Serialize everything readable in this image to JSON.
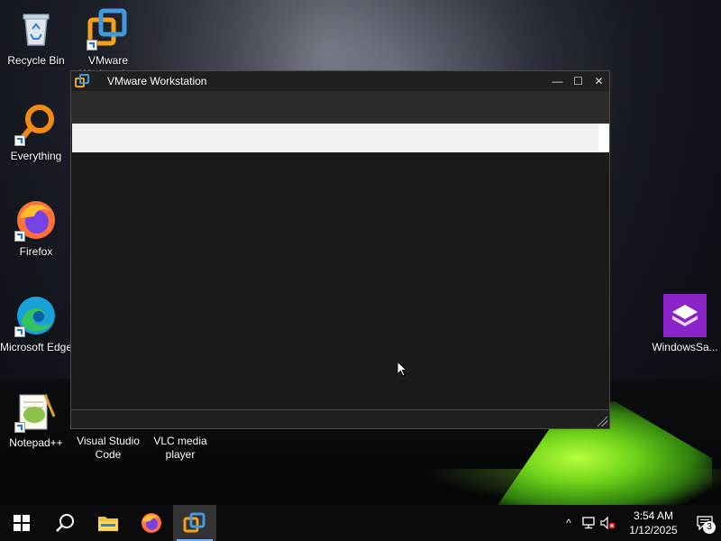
{
  "desktop": {
    "icons": [
      {
        "label": "Recycle Bin"
      },
      {
        "label": "VMware Workstation"
      },
      {
        "label": "Everything"
      },
      {
        "label": "Firefox"
      },
      {
        "label": "Microsoft Edge"
      },
      {
        "label": "Notepad++"
      },
      {
        "label": "Visual Studio Code"
      },
      {
        "label": "VLC media player"
      },
      {
        "label": "WindowsSa..."
      }
    ]
  },
  "window": {
    "title": "VMware Workstation",
    "minimize_glyph": "—",
    "maximize_glyph": "☐",
    "close_glyph": "✕"
  },
  "taskbar": {
    "clock_time": "3:54 AM",
    "clock_date": "1/12/2025",
    "notification_count": "3",
    "overflow_glyph": "^"
  },
  "colors": {
    "vmware_orange": "#f5a21a",
    "vmware_blue": "#3f9ae0",
    "loading_bar": "#f0f0f0",
    "taskbar_accent": "#6cb3ff"
  }
}
